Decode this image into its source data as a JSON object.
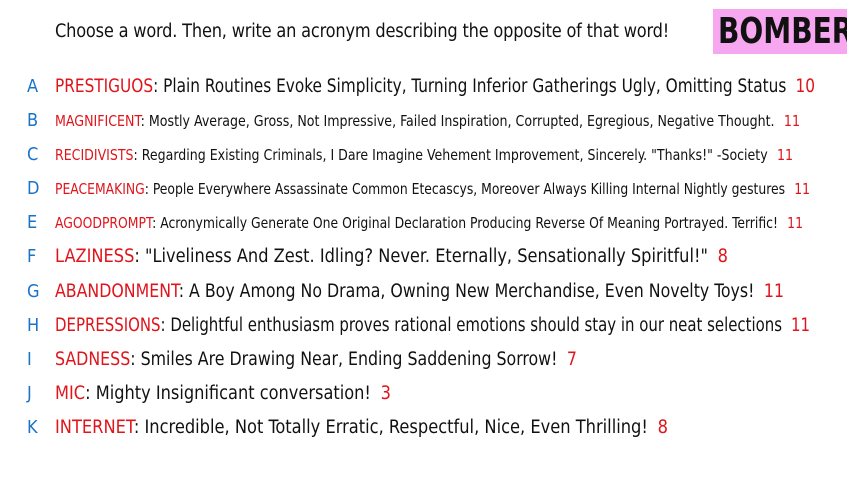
{
  "prompt": "Choose a word. Then, write an acronym describing the opposite of that word!",
  "badge": "BOMBER",
  "colors": {
    "letter": "#1a73c9",
    "word": "#e0141b",
    "score": "#e0141b",
    "text": "#111111",
    "badge_bg": "#f7a6f0"
  },
  "entries": [
    {
      "letter": "A",
      "word": "PRESTIGUOS",
      "acronym": "Plain Routines Evoke Simplicity, Turning Inferior Gatherings Ugly, Omitting Status",
      "score": "10"
    },
    {
      "letter": "B",
      "word": "MAGNIFICENT",
      "acronym": "Mostly Average, Gross, Not Impressive, Failed Inspiration, Corrupted, Egregious, Negative Thought.",
      "score": "11"
    },
    {
      "letter": "C",
      "word": "RECIDIVISTS",
      "acronym": "Regarding Existing Criminals, I Dare Imagine Vehement Improvement, Sincerely. \"Thanks!\" -Society",
      "score": "11"
    },
    {
      "letter": "D",
      "word": "PEACEMAKING",
      "acronym": "People Everywhere Assassinate Common Etecascys, Moreover Always Killing Internal Nightly gestures",
      "score": "11"
    },
    {
      "letter": "E",
      "word": "AGOODPROMPT",
      "acronym": "Acronymically Generate One Original Declaration Producing Reverse Of Meaning Portrayed. Terrific!",
      "score": "11"
    },
    {
      "letter": "F",
      "word": "LAZINESS",
      "acronym": "\"Liveliness And Zest. Idling? Never. Eternally, Sensationally Spiritful!\"",
      "score": "8"
    },
    {
      "letter": "G",
      "word": "ABANDONMENT",
      "acronym": "A Boy Among No Drama, Owning New Merchandise, Even Novelty Toys!",
      "score": "11"
    },
    {
      "letter": "H",
      "word": "DEPRESSIONS",
      "acronym": "Delightful enthusiasm proves rational emotions should stay in our neat selections",
      "score": "11"
    },
    {
      "letter": "I",
      "word": "SADNESS",
      "acronym": "Smiles Are Drawing Near, Ending Saddening Sorrow!",
      "score": "7"
    },
    {
      "letter": "J",
      "word": "MIC",
      "acronym": "Mighty Insignificant conversation!",
      "score": "3"
    },
    {
      "letter": "K",
      "word": "INTERNET",
      "acronym": "Incredible, Not Totally Erratic, Respectful, Nice, Even Thrilling!",
      "score": "8"
    }
  ]
}
